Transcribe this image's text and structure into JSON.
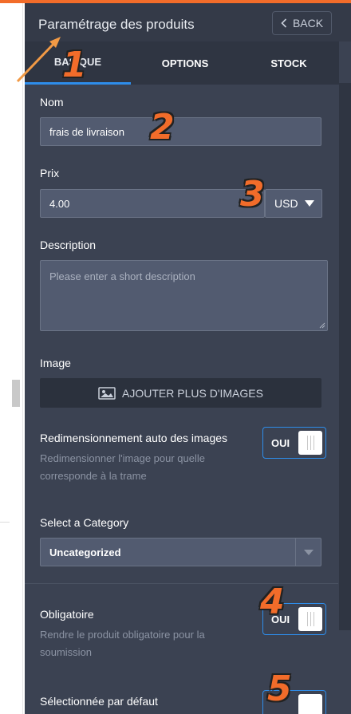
{
  "header": {
    "title": "Paramétrage des produits",
    "back_label": "BACK"
  },
  "tabs": [
    {
      "label": "BASIQUE",
      "active": true
    },
    {
      "label": "OPTIONS",
      "active": false
    },
    {
      "label": "STOCK",
      "active": false
    }
  ],
  "fields": {
    "name": {
      "label": "Nom",
      "value": "frais de livraison"
    },
    "price": {
      "label": "Prix",
      "value": "4.00",
      "currency": "USD"
    },
    "description": {
      "label": "Description",
      "placeholder": "Please enter a short description"
    },
    "image": {
      "label": "Image",
      "button_label": "AJOUTER PLUS D'IMAGES"
    },
    "auto_resize": {
      "label": "Redimensionnement auto des images",
      "help": "Redimensionner l'image pour quelle corresponde à la trame",
      "toggle": "OUI"
    },
    "category": {
      "label": "Select a Category",
      "value": "Uncategorized"
    },
    "required": {
      "label": "Obligatoire",
      "help": "Rendre le produit obligatoire pour la soumission",
      "toggle": "OUI"
    },
    "default_selected": {
      "label": "Sélectionnée par défaut"
    }
  },
  "annotations": [
    "1",
    "2",
    "3",
    "4",
    "5"
  ],
  "colors": {
    "accent": "#2e8dea",
    "panel_bg": "#3b4252",
    "header_bg": "#343a48",
    "input_bg": "#525b70",
    "annotation": "#f26c2a"
  },
  "icons": [
    "chevron-left-icon",
    "image-icon",
    "caret-down-icon",
    "resize-grip-icon"
  ]
}
